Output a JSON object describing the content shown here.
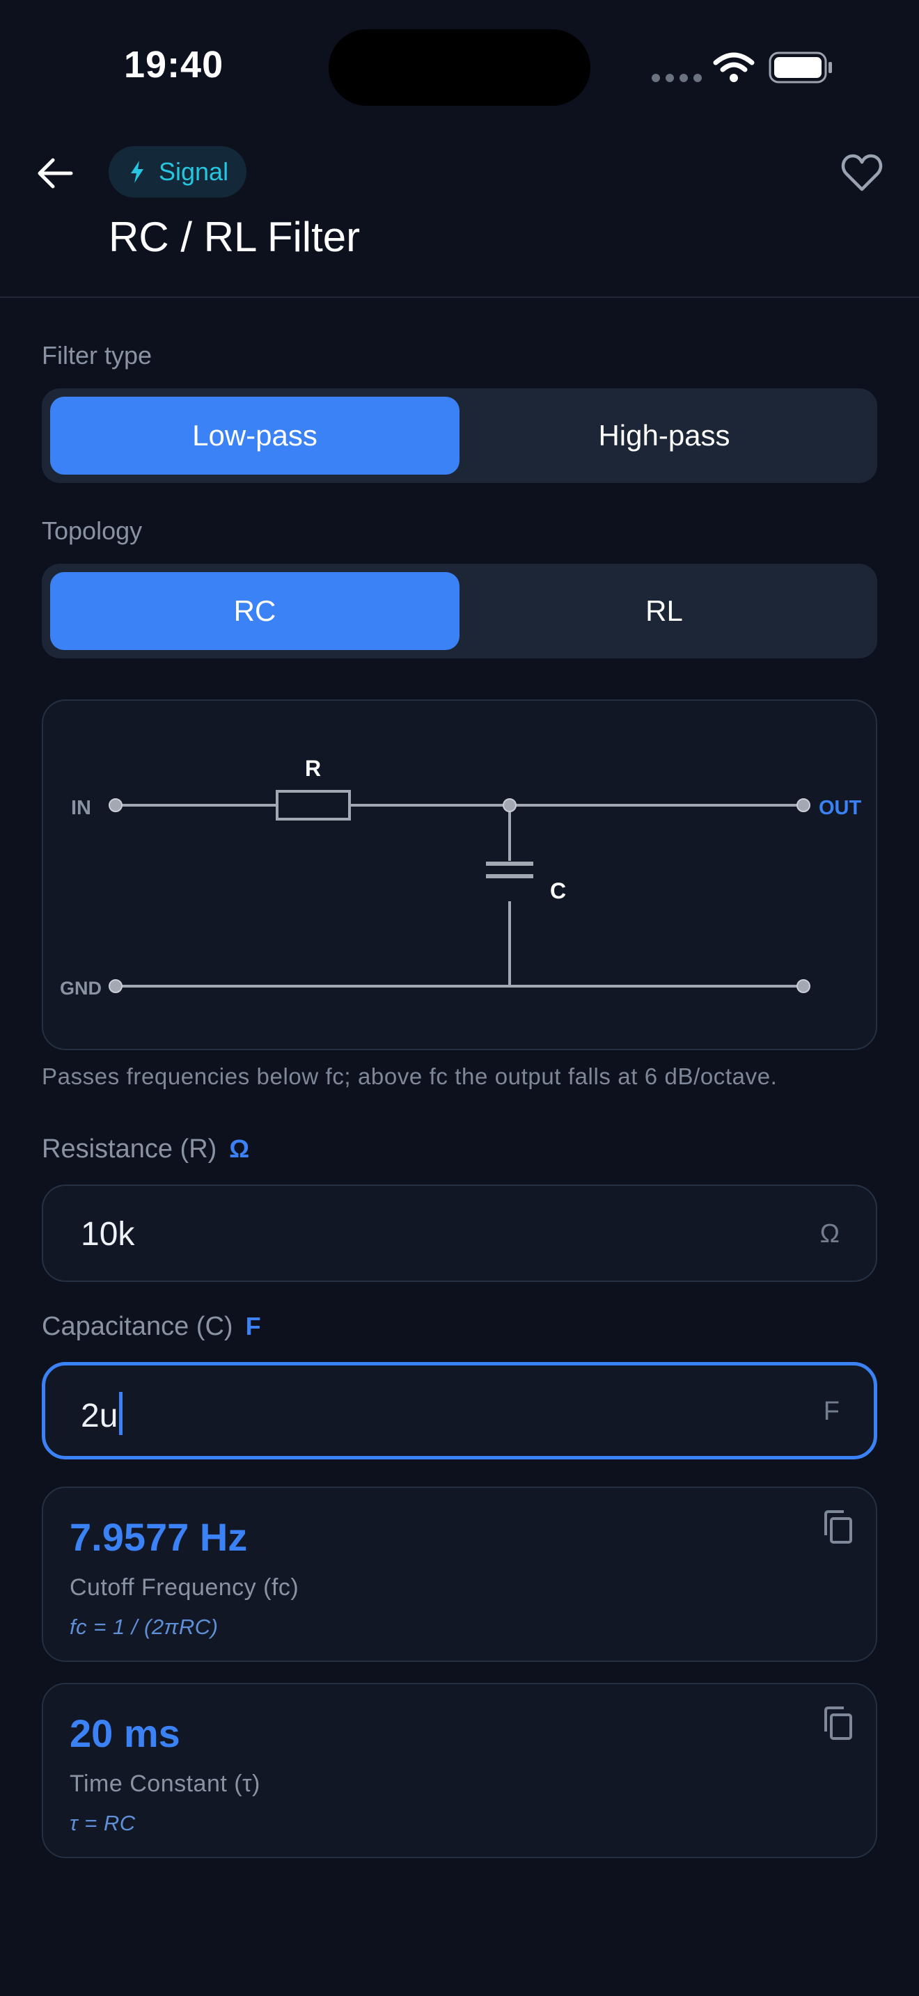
{
  "status_bar": {
    "time": "19:40"
  },
  "header": {
    "category_chip": "Signal",
    "title": "RC / RL Filter"
  },
  "filter_type": {
    "label": "Filter type",
    "options": [
      "Low-pass",
      "High-pass"
    ],
    "selected": "Low-pass"
  },
  "topology": {
    "label": "Topology",
    "options": [
      "RC",
      "RL"
    ],
    "selected": "RC"
  },
  "schematic": {
    "in_label": "IN",
    "out_label": "OUT",
    "gnd_label": "GND",
    "resistor_label": "R",
    "capacitor_label": "C"
  },
  "hint": "Passes frequencies below fc; above fc the output falls at 6 dB/octave.",
  "resistance": {
    "label": "Resistance (R)",
    "unit_badge": "Ω",
    "value": "10k",
    "unit": "Ω"
  },
  "capacitance": {
    "label": "Capacitance (C)",
    "unit_badge": "F",
    "value": "2u",
    "unit": "F"
  },
  "results": [
    {
      "value": "7.9577 Hz",
      "label": "Cutoff Frequency (fc)",
      "formula": "fc = 1 / (2πRC)"
    },
    {
      "value": "20 ms",
      "label": "Time Constant (τ)",
      "formula": "τ = RC"
    }
  ],
  "colors": {
    "background": "#0c111d",
    "accent": "#3b82f6",
    "chip_text": "#27c6e0"
  }
}
